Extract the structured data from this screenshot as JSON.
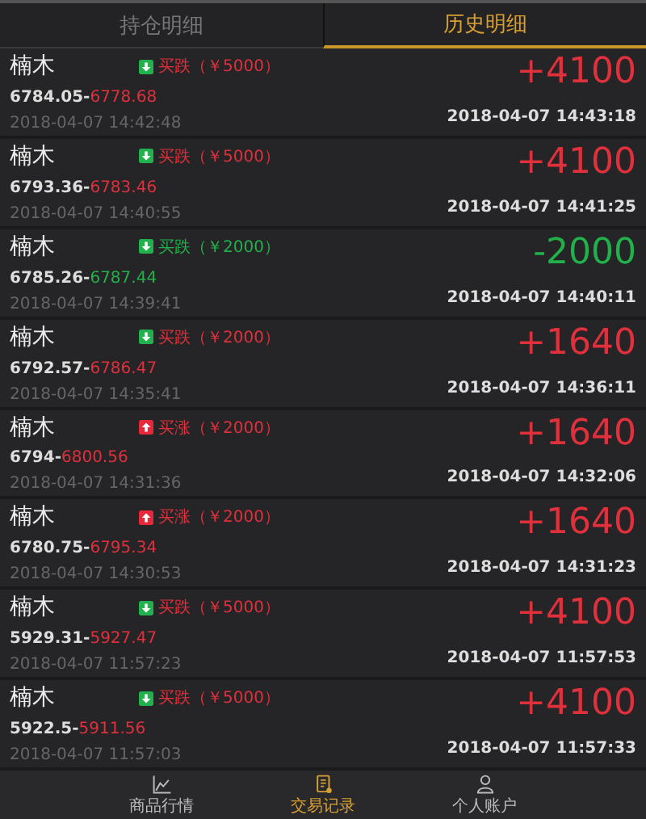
{
  "tabs": [
    {
      "label": "持仓明细",
      "selected": false
    },
    {
      "label": "历史明细",
      "selected": true
    }
  ],
  "trades": [
    {
      "name": "楠木",
      "kind": "down",
      "order": "买跌（￥5000）",
      "open_price": "6784.05-",
      "close_price": "6778.68",
      "open_time": "2018-04-07 14:42:48",
      "color": "#e0303c",
      "result": "+4100",
      "close_time": "2018-04-07 14:43:18"
    },
    {
      "name": "楠木",
      "kind": "down",
      "order": "买跌（￥5000）",
      "open_price": "6793.36-",
      "close_price": "6783.46",
      "open_time": "2018-04-07 14:40:55",
      "color": "#e0303c",
      "result": "+4100",
      "close_time": "2018-04-07 14:41:25"
    },
    {
      "name": "楠木",
      "kind": "down",
      "order": "买跌（￥2000）",
      "open_price": "6785.26-",
      "close_price": "6787.44",
      "open_time": "2018-04-07 14:39:41",
      "color": "#22b04a",
      "result": "-2000",
      "close_time": "2018-04-07 14:40:11"
    },
    {
      "name": "楠木",
      "kind": "down",
      "order": "买跌（￥2000）",
      "open_price": "6792.57-",
      "close_price": "6786.47",
      "open_time": "2018-04-07 14:35:41",
      "color": "#e0303c",
      "result": "+1640",
      "close_time": "2018-04-07 14:36:11"
    },
    {
      "name": "楠木",
      "kind": "up",
      "order": "买涨（￥2000）",
      "open_price": "6794-",
      "close_price": "6800.56",
      "open_time": "2018-04-07 14:31:36",
      "color": "#e0303c",
      "result": "+1640",
      "close_time": "2018-04-07 14:32:06"
    },
    {
      "name": "楠木",
      "kind": "up",
      "order": "买涨（￥2000）",
      "open_price": "6780.75-",
      "close_price": "6795.34",
      "open_time": "2018-04-07 14:30:53",
      "color": "#e0303c",
      "result": "+1640",
      "close_time": "2018-04-07 14:31:23"
    },
    {
      "name": "楠木",
      "kind": "down",
      "order": "买跌（￥5000）",
      "open_price": "5929.31-",
      "close_price": "5927.47",
      "open_time": "2018-04-07 11:57:23",
      "color": "#e0303c",
      "result": "+4100",
      "close_time": "2018-04-07 11:57:53"
    },
    {
      "name": "楠木",
      "kind": "down",
      "order": "买跌（￥5000）",
      "open_price": "5922.5-",
      "close_price": "5911.56",
      "open_time": "2018-04-07 11:57:03",
      "color": "#e0303c",
      "result": "+4100",
      "close_time": "2018-04-07 11:57:33"
    }
  ],
  "bottom_nav": [
    {
      "label": "商品行情",
      "kind": "chart",
      "selected": false
    },
    {
      "label": "交易记录",
      "kind": "record",
      "selected": true
    },
    {
      "label": "个人账户",
      "kind": "person",
      "selected": false
    }
  ]
}
